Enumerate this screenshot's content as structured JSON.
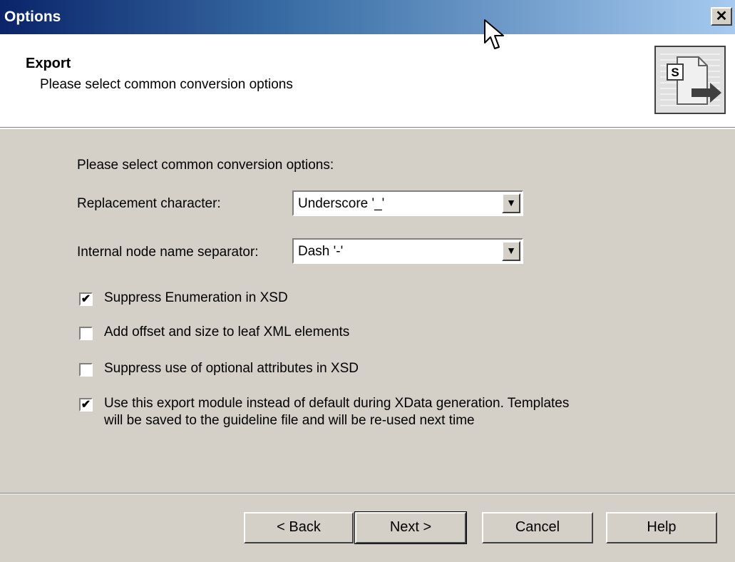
{
  "window": {
    "title": "Options",
    "close_label": "✕"
  },
  "header": {
    "title": "Export",
    "subtitle": "Please select common conversion options",
    "icon_letter": "S"
  },
  "content": {
    "intro": "Please select common conversion options:",
    "replacement": {
      "label": "Replacement character:",
      "value": "Underscore '_'"
    },
    "separator": {
      "label": "Internal node name separator:",
      "value": "Dash '-'"
    },
    "checkboxes": [
      {
        "label": "Suppress Enumeration in XSD",
        "checked": true
      },
      {
        "label": "Add offset and size to leaf XML elements",
        "checked": false
      },
      {
        "label": "Suppress use of optional attributes in XSD",
        "checked": false
      },
      {
        "label": "Use this export module instead of default during XData generation. Templates",
        "label2": "will be saved to the guideline file and will be re-used next time",
        "checked": true
      }
    ]
  },
  "buttons": {
    "back": "< Back",
    "next": "Next >",
    "cancel": "Cancel",
    "help": "Help"
  },
  "icons": {
    "checkmark": "✔",
    "dropdown": "▼"
  }
}
